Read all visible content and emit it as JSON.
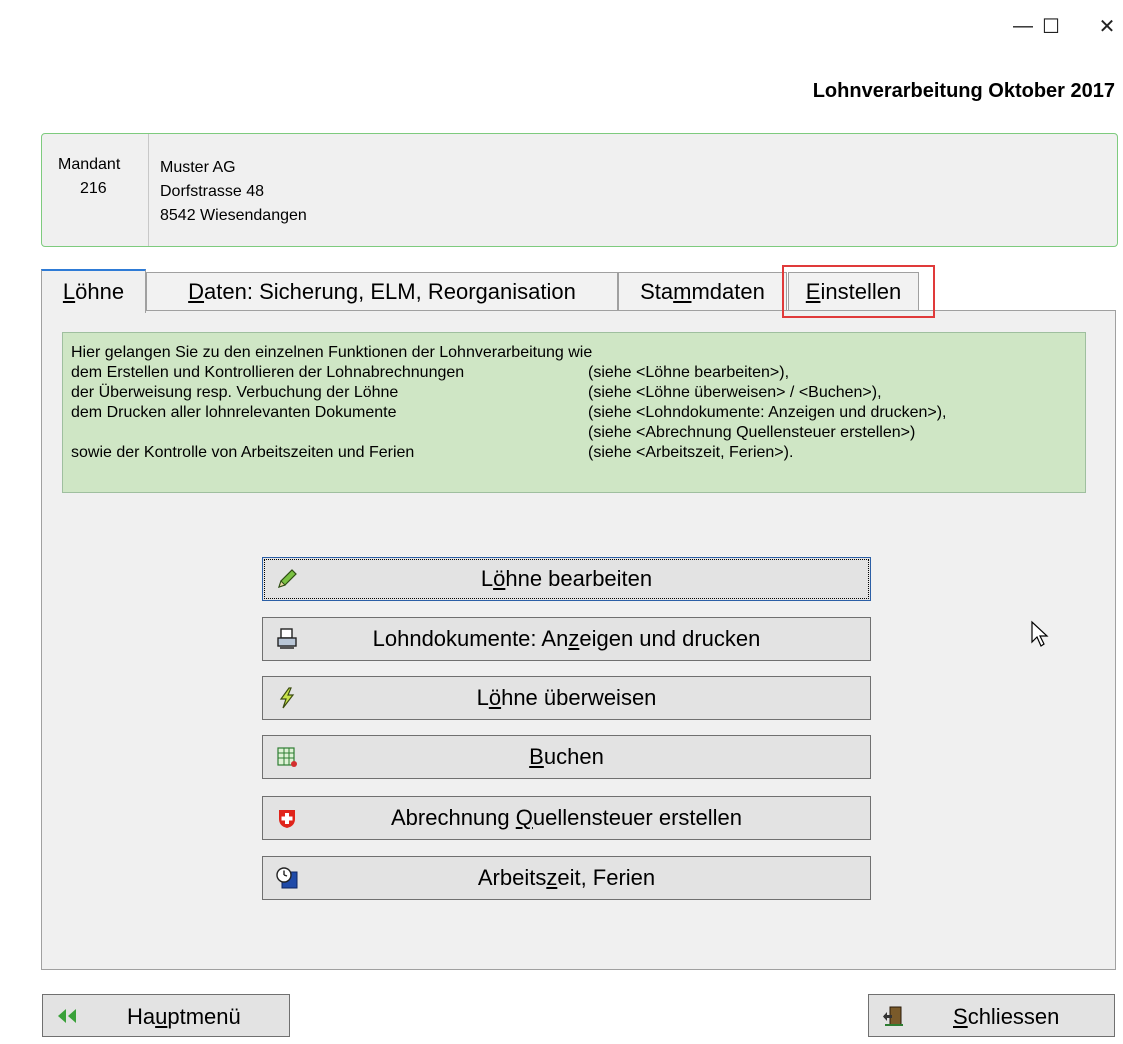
{
  "window": {
    "title": "Lohnverarbeitung Oktober 2017",
    "controls": {
      "minimize": "—",
      "maximize": "☐",
      "close": "✕"
    }
  },
  "client": {
    "label": "Mandant",
    "number": "216",
    "lines": [
      "Muster AG",
      "Dorfstrasse 48",
      "8542 Wiesendangen"
    ]
  },
  "tabs": [
    {
      "pre": "",
      "u": "L",
      "post": "öhne"
    },
    {
      "pre": "",
      "u": "D",
      "post": "aten: Sicherung, ELM, Reorganisation"
    },
    {
      "pre": "Sta",
      "u": "m",
      "post": "mdaten"
    },
    {
      "pre": "",
      "u": "E",
      "post": "instellen"
    }
  ],
  "info": {
    "rows": [
      {
        "left": "Hier gelangen Sie zu den einzelnen Funktionen der Lohnverarbeitung wie",
        "right": ""
      },
      {
        "left": "dem Erstellen und Kontrollieren der Lohnabrechnungen",
        "right": "(siehe <Löhne bearbeiten>),"
      },
      {
        "left": "der Überweisung resp. Verbuchung der Löhne",
        "right": "(siehe <Löhne überweisen> / <Buchen>),"
      },
      {
        "left": "dem Drucken aller lohnrelevanten Dokumente",
        "right": "(siehe <Lohndokumente: Anzeigen und drucken>),"
      },
      {
        "left": "",
        "right": "(siehe <Abrechnung Quellensteuer erstellen>)"
      },
      {
        "left": "sowie der Kontrolle von Arbeitszeiten und Ferien",
        "right": "(siehe <Arbeitszeit, Ferien>)."
      }
    ]
  },
  "actions": [
    {
      "icon": "pencil-icon",
      "pre": "L",
      "u": "ö",
      "post": "hne bearbeiten"
    },
    {
      "icon": "printer-icon",
      "pre": "Lohndokumente: An",
      "u": "z",
      "post": "eigen und drucken"
    },
    {
      "icon": "lightning-icon",
      "pre": "L",
      "u": "ö",
      "post": "hne überweisen"
    },
    {
      "icon": "ledger-icon",
      "pre": "",
      "u": "B",
      "post": "uchen"
    },
    {
      "icon": "swiss-cross-icon",
      "pre": "Abrechnung ",
      "u": "Q",
      "post": "uellensteuer erstellen"
    },
    {
      "icon": "clock-calendar-icon",
      "pre": "Arbeits",
      "u": "z",
      "post": "eit, Ferien"
    }
  ],
  "bottom": {
    "main_menu": {
      "pre": "Ha",
      "u": "u",
      "post": "ptmenü"
    },
    "close": {
      "pre": "",
      "u": "S",
      "post": "chliessen"
    }
  },
  "colors": {
    "accent_tab": "#2e7bd6",
    "highlight": "#e03a3a",
    "info_bg": "#cfe6c5",
    "client_border": "#7ecb7e"
  }
}
